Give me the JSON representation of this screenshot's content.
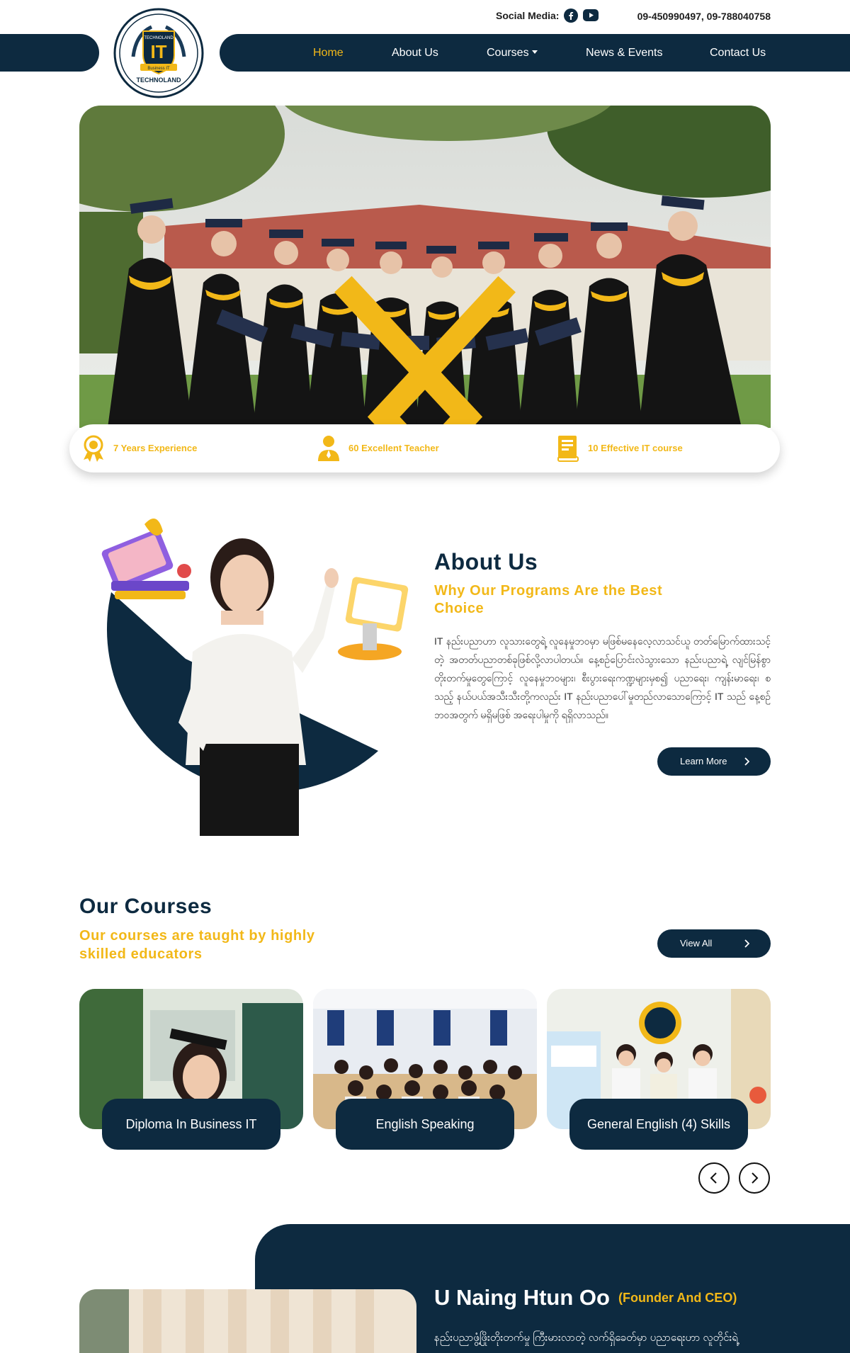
{
  "topbar": {
    "social_label": "Social Media:",
    "social_icons": [
      "facebook-icon",
      "youtube-icon"
    ],
    "phones": "09-450990497, 09-788040758"
  },
  "brand": {
    "logo_text": "TECHNOLAND",
    "logo_ribbon": "Business IT",
    "colors": {
      "navy": "#0d2a40",
      "gold": "#f2b818"
    }
  },
  "nav": {
    "items": [
      {
        "label": "Home",
        "active": true
      },
      {
        "label": "About Us"
      },
      {
        "label": "Courses",
        "dropdown": true
      },
      {
        "label": "News & Events"
      },
      {
        "label": "Contact Us"
      }
    ]
  },
  "hero": {
    "slider_icons": [
      "chevron-left-icon",
      "chevron-right-icon"
    ]
  },
  "stats": [
    {
      "icon": "award-icon",
      "label": "7 Years Experience"
    },
    {
      "icon": "teacher-icon",
      "label": "60 Excellent Teacher"
    },
    {
      "icon": "book-icon",
      "label": "10 Effective IT course"
    }
  ],
  "about": {
    "title": "About Us",
    "subtitle": "Why Our Programs Are the Best Choice",
    "text": "IT နည်းပညာဟာ လူသားတွေရဲ့ လူနေမှုဘဝမှာ မဖြစ်မနေလေ့လာသင်ယူ တတ်မြောက်ထားသင့်တဲ့ အတတ်ပညာတစ်ခုဖြစ်လို့လာပါတယ်။ နေ့စဉ်ပြောင်းလဲသွားသော နည်းပညာရဲ့ လျင်မြန်စွာတိုးတက်မှုတွေကြောင့် လူနေမှုဘဝများ၊ စီးပွားရေးကဏ္ဍများမှစ၍ ပညာရေး၊ ကျန်းမာရေး၊ စသည့် နယ်ပယ်အသီးသီးတို့ကလည်း IT နည်းပညာပေါ်မှုတည်လာသောကြောင့် IT သည် နေ့စဉ်ဘဝအတွက် မရှိမဖြစ် အရေးပါမှုကို ရရှိလာသည်။",
    "button": "Learn More"
  },
  "courses": {
    "title": "Our Courses",
    "subtitle": "Our courses are taught by highly skilled educators",
    "view_all": "View All",
    "items": [
      {
        "label": "Diploma In Business IT"
      },
      {
        "label": "English Speaking"
      },
      {
        "label": "General English (4) Skills"
      }
    ],
    "nav_icons": [
      "chevron-left-icon",
      "chevron-right-icon"
    ]
  },
  "founder": {
    "name": "U Naing Htun Oo",
    "role": "(Founder And CEO)",
    "text": "နည်းပညာဖွံ့ဖြိုးတိုးတက်မှု ကြီးမားလာတဲ့ လက်ရှိခေတ်မှာ ပညာရေးဟာ လူတိုင်းရဲ့"
  }
}
